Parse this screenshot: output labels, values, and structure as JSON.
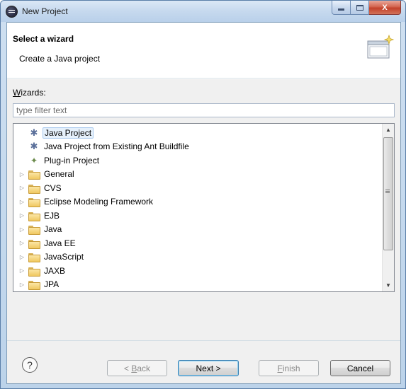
{
  "window": {
    "title": "New Project",
    "minimize_icon": "minimize-icon",
    "maximize_icon": "maximize-icon",
    "close_glyph": "X"
  },
  "banner": {
    "title": "Select a wizard",
    "description": "Create a Java project"
  },
  "wizards": {
    "label_accel": "W",
    "label_rest": "izards:",
    "filter_placeholder": "type filter text",
    "items": [
      {
        "label": "Java Project",
        "kind": "project",
        "selected": true,
        "expandable": false
      },
      {
        "label": "Java Project from Existing Ant Buildfile",
        "kind": "project",
        "selected": false,
        "expandable": false
      },
      {
        "label": "Plug-in Project",
        "kind": "plugin",
        "selected": false,
        "expandable": false
      },
      {
        "label": "General",
        "kind": "folder",
        "selected": false,
        "expandable": true
      },
      {
        "label": "CVS",
        "kind": "folder",
        "selected": false,
        "expandable": true
      },
      {
        "label": "Eclipse Modeling Framework",
        "kind": "folder",
        "selected": false,
        "expandable": true
      },
      {
        "label": "EJB",
        "kind": "folder",
        "selected": false,
        "expandable": true
      },
      {
        "label": "Java",
        "kind": "folder",
        "selected": false,
        "expandable": true
      },
      {
        "label": "Java EE",
        "kind": "folder",
        "selected": false,
        "expandable": true
      },
      {
        "label": "JavaScript",
        "kind": "folder",
        "selected": false,
        "expandable": true
      },
      {
        "label": "JAXB",
        "kind": "folder",
        "selected": false,
        "expandable": true
      },
      {
        "label": "JPA",
        "kind": "folder",
        "selected": false,
        "expandable": true
      }
    ]
  },
  "footer": {
    "help_glyph": "?",
    "back": {
      "accel": "B",
      "rest": "ack",
      "prefix": "< ",
      "enabled": false
    },
    "next": {
      "label": "Next >",
      "enabled": true
    },
    "finish": {
      "accel": "F",
      "rest": "inish",
      "enabled": false
    },
    "cancel": {
      "label": "Cancel",
      "enabled": true
    }
  }
}
